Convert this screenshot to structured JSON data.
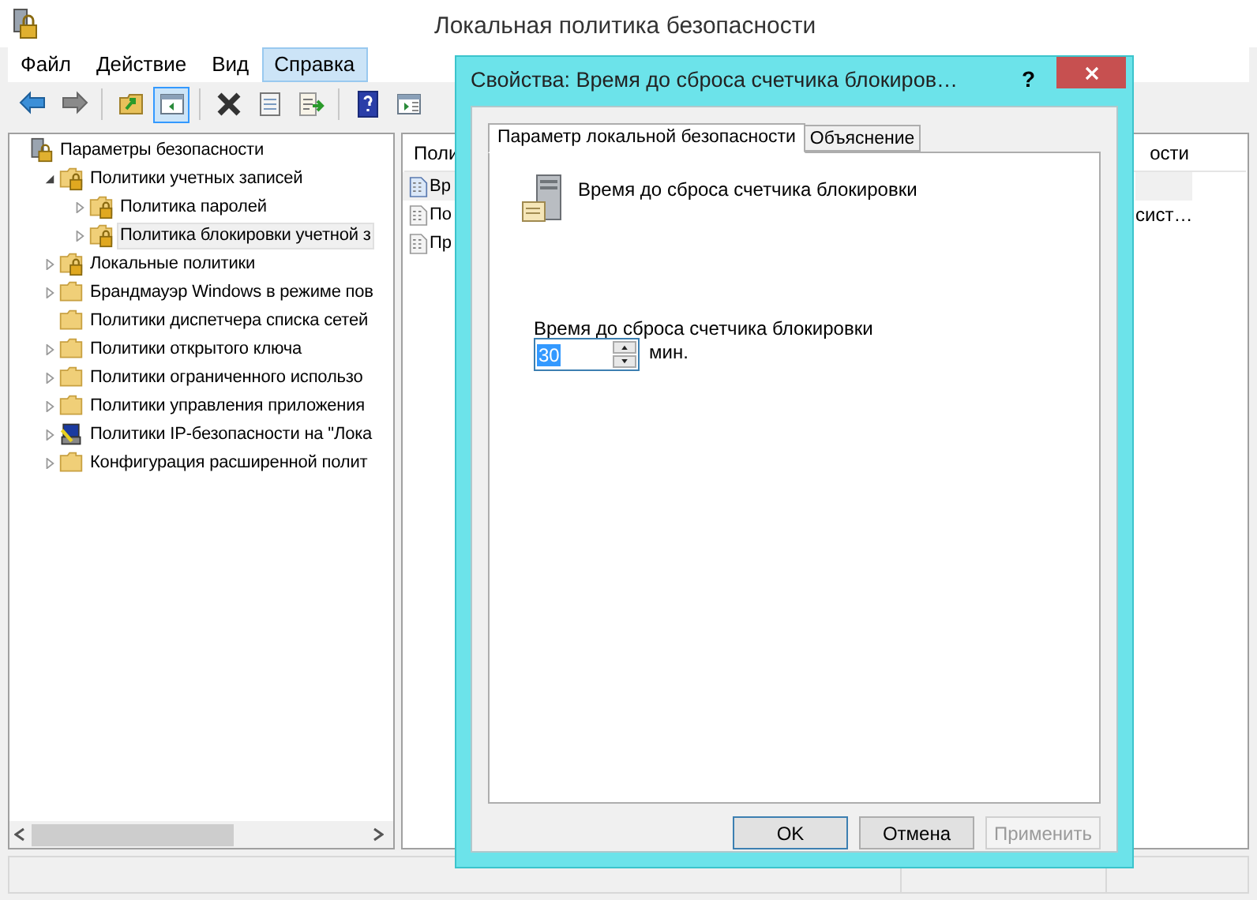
{
  "window": {
    "title": "Локальная политика безопасности"
  },
  "menu": [
    {
      "label": "Файл",
      "selected": false
    },
    {
      "label": "Действие",
      "selected": false
    },
    {
      "label": "Вид",
      "selected": false
    },
    {
      "label": "Справка",
      "selected": true
    }
  ],
  "toolbar": [
    {
      "kind": "back",
      "active": false
    },
    {
      "kind": "forward",
      "active": false
    },
    {
      "kind": "separator"
    },
    {
      "kind": "up",
      "active": false
    },
    {
      "kind": "tree",
      "active": true
    },
    {
      "kind": "separator"
    },
    {
      "kind": "delete",
      "active": false
    },
    {
      "kind": "properties",
      "active": false
    },
    {
      "kind": "export",
      "active": false
    },
    {
      "kind": "separator"
    },
    {
      "kind": "help",
      "active": false
    },
    {
      "kind": "panel",
      "active": false
    }
  ],
  "tree": [
    {
      "label": "Параметры безопасности",
      "kind": "root",
      "selected": false,
      "children": [
        {
          "label": "Политики учетных записей",
          "kind": "locked",
          "expanded": true,
          "selected": false,
          "children": [
            {
              "label": "Политика паролей",
              "kind": "locked",
              "expanded": false,
              "selected": false
            },
            {
              "label": "Политика блокировки учетной з",
              "kind": "locked",
              "expanded": false,
              "selected": true
            }
          ]
        },
        {
          "label": "Локальные политики",
          "kind": "locked",
          "expanded": false,
          "selected": false
        },
        {
          "label": "Брандмауэр Windows в режиме пов",
          "kind": "folder",
          "expanded": false,
          "selected": false
        },
        {
          "label": "Политики диспетчера списка сетей",
          "kind": "folder",
          "selected": false
        },
        {
          "label": "Политики открытого ключа",
          "kind": "folder",
          "expanded": false,
          "selected": false
        },
        {
          "label": "Политики ограниченного использо",
          "kind": "folder",
          "expanded": false,
          "selected": false
        },
        {
          "label": "Политики управления приложения",
          "kind": "folder",
          "expanded": false,
          "selected": false
        },
        {
          "label": "Политики IP-безопасности на \"Лока",
          "kind": "ip",
          "expanded": false,
          "selected": false
        },
        {
          "label": "Конфигурация расширенной полит",
          "kind": "folder",
          "expanded": false,
          "selected": false
        }
      ]
    }
  ],
  "list": {
    "column_1": "Поли",
    "column_2": "ости",
    "rows": [
      {
        "cell_1": "Вр",
        "selected": true
      },
      {
        "cell_1": "По",
        "cell_2": "сист…",
        "selected": false
      },
      {
        "cell_1": "Пр",
        "selected": false
      }
    ]
  },
  "dialog": {
    "title": "Свойства: Время до сброса счетчика блокиров…",
    "help": "?",
    "tabs": [
      {
        "label": "Параметр локальной безопасности",
        "selected": true
      },
      {
        "label": "Объяснение",
        "selected": false
      }
    ],
    "heading": "Время до сброса счетчика блокировки",
    "field_label": "Время до сброса счетчика блокировки",
    "value": "30",
    "unit": "мин.",
    "buttons": [
      {
        "label": "OK",
        "default": true,
        "disabled": false
      },
      {
        "label": "Отмена",
        "default": false,
        "disabled": false
      },
      {
        "label": "Применить",
        "default": false,
        "disabled": true
      }
    ]
  }
}
